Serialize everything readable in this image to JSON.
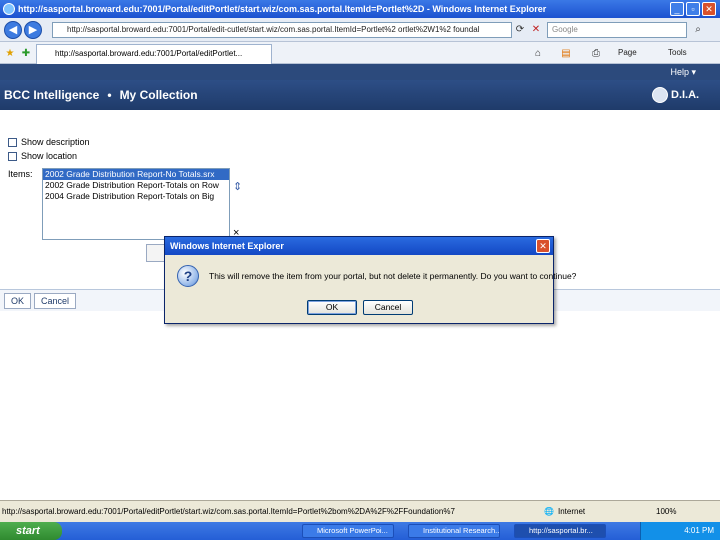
{
  "browser": {
    "window_title": "http://sasportal.broward.edu:7001/Portal/editPortlet/start.wiz/com.sas.portal.ItemId=Portlet%2D - Windows Internet Explorer",
    "address": "http://sasportal.broward.edu:7001/Portal/edit-cutlet/start.wiz/com.sas.portal.ItemId=Portlet%2 ortlet%2W1%2 foundal",
    "search_placeholder": "Google",
    "tab_label": "http://sasportal.broward.edu:7001/Portal/editPortlet...",
    "page_menu": "Page",
    "tools_menu": "Tools",
    "help": "Help"
  },
  "app": {
    "brand": "BCC Intelligence",
    "separator": "•",
    "section": "My Collection",
    "logo_text": "D.I.A."
  },
  "form": {
    "show_description": "Show description",
    "show_location": "Show location",
    "items_label": "Items:",
    "items": [
      "2002 Grade Distribution Report-No Totals.srx",
      "2002 Grade Distribution Report-Totals on Row",
      "2004 Grade Distribution Report-Totals on Big"
    ],
    "selected_index": 0,
    "move_up_glyph": "⇕",
    "remove_glyph": "×",
    "ok": "OK",
    "cancel": "Cancel"
  },
  "dialog": {
    "title": "Windows Internet Explorer",
    "message": "This will remove the item from your portal, but not delete it permanently. Do you want to continue?",
    "ok": "OK",
    "cancel": "Cancel"
  },
  "status": {
    "url": "http://sasportal.broward.edu:7001/Portal/editPortlet/start.wiz/com.sas.portal.ItemId=Portlet%2bom%2DA%2F%2FFoundation%7",
    "zone": "Internet",
    "zoom": "100%"
  },
  "taskbar": {
    "start": "start",
    "tasks": [
      "Microsoft PowerPoi...",
      "Institutional Research...",
      "http://sasportal.br..."
    ],
    "clock": "4:01 PM"
  }
}
